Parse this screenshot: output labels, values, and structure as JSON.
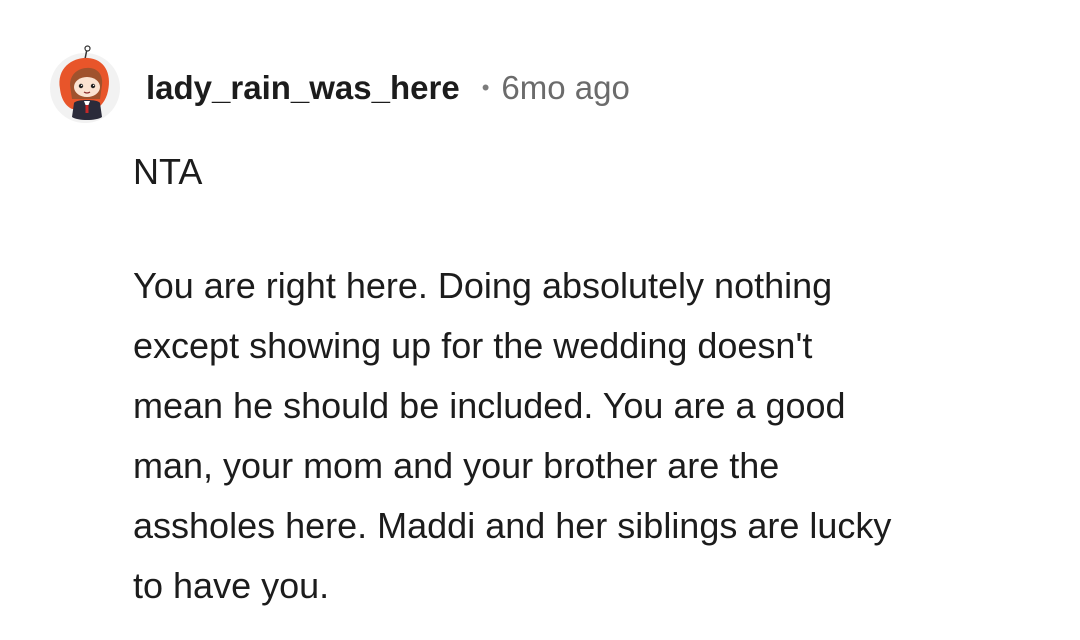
{
  "comment": {
    "author": "lady_rain_was_here",
    "separator": "•",
    "age": "6mo ago",
    "avatar_icon": "snoo-avatar-icon",
    "verdict": "NTA",
    "body_lines": [
      "You are right here. Doing absolutely nothing",
      "except showing up for the wedding doesn't",
      "mean he should be included. You are a good",
      "man, your mom and your brother are the",
      "assholes here. Maddi and her siblings are lucky",
      "to have you."
    ]
  },
  "colors": {
    "username": "#1c1c1c",
    "meta": "#6b6b6b",
    "text": "#1c1c1c",
    "avatar_hood": "#e8552a",
    "background": "#ffffff"
  }
}
